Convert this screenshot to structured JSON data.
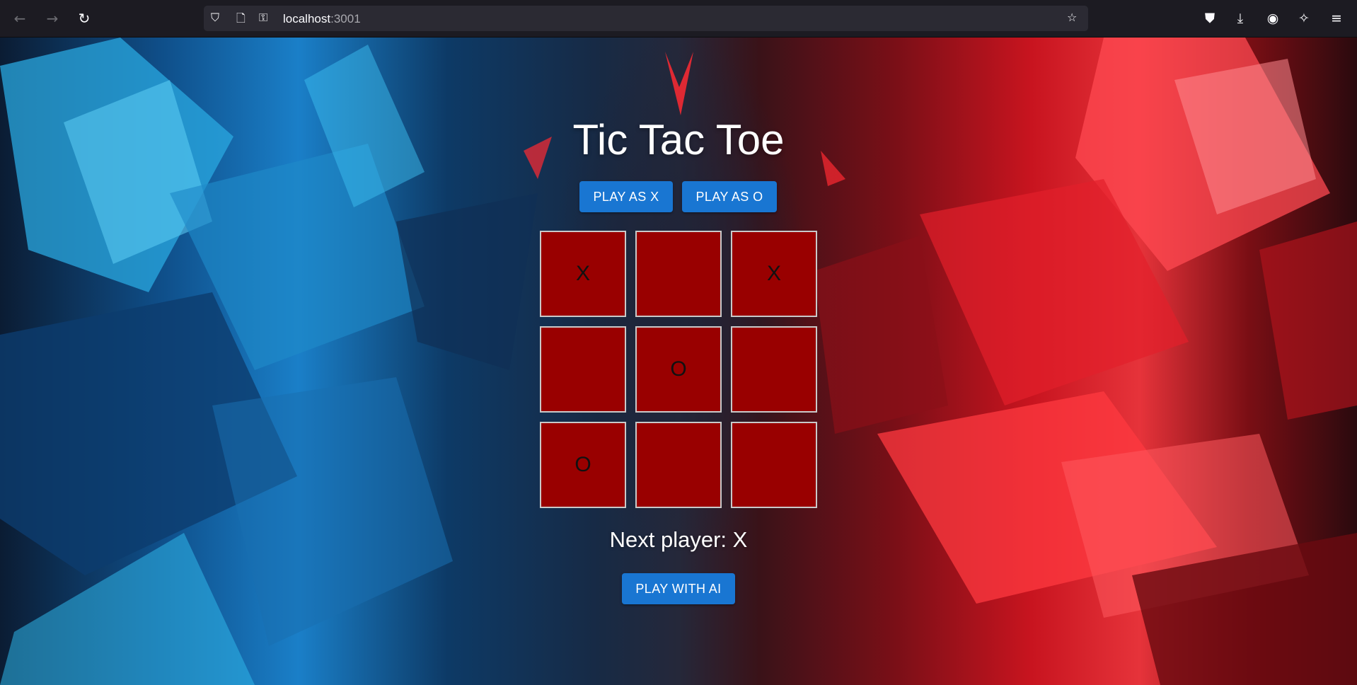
{
  "browser": {
    "url_host": "localhost",
    "url_port": ":3001"
  },
  "game": {
    "title": "Tic Tac Toe",
    "play_as_x_label": "PLAY AS X",
    "play_as_o_label": "PLAY AS O",
    "board": [
      "X",
      "",
      "X",
      "",
      "O",
      "",
      "O",
      "",
      ""
    ],
    "status_text": "Next player: X",
    "play_with_ai_label": "PLAY WITH AI"
  },
  "colors": {
    "cell_background": "#990000",
    "button_primary": "#1976d2",
    "browser_chrome": "#1c1b22"
  },
  "icons": [
    "back-arrow-icon",
    "forward-arrow-icon",
    "reload-icon",
    "shield-icon",
    "page-icon",
    "permissions-icon",
    "bookmark-star-icon",
    "pocket-icon",
    "download-icon",
    "account-icon",
    "extensions-icon",
    "menu-icon"
  ]
}
